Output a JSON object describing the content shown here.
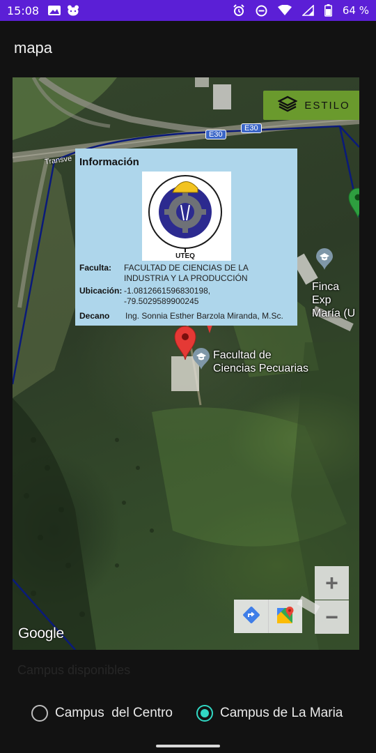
{
  "status_bar": {
    "time": "15:08",
    "battery": "64 %",
    "icons": [
      "gallery-icon",
      "cat-face-icon",
      "alarm-icon",
      "do-not-disturb-icon",
      "wifi-icon",
      "signal-icon",
      "battery-icon"
    ]
  },
  "app_bar": {
    "title": "mapa"
  },
  "map": {
    "style_button_label": "ESTILO",
    "road_labels": [
      "Transve",
      "E30",
      "E30"
    ],
    "info_window": {
      "title": "Información",
      "logo_text": "INGENIERIA EN SEGURIDAD INDUSTRIAL Y SALUD OCUPACIONAL",
      "logo_subtext": "UTEQ",
      "rows": [
        {
          "label": "Faculta:",
          "value": "FACULTAD DE CIENCIAS DE LA\nINDUSTRIA Y LA PRODUCCIÓN"
        },
        {
          "label": "Ubicación:",
          "value": "-1.0812661596830198,\n-79.5029589900245"
        },
        {
          "label": "Decano",
          "value": "Ing. Sonnia Esther Barzola Miranda, M.Sc."
        }
      ]
    },
    "places": [
      {
        "label": "Facultad de\nCiencias Pecuarias"
      },
      {
        "label": "Finca Exp\nMaría (U"
      }
    ],
    "zoom_in_label": "+",
    "zoom_out_label": "−",
    "attribution": "Google",
    "colors": {
      "red_marker": "#e53935",
      "green_marker": "#2e9e3f",
      "place_pin": "#7f97a8",
      "boundary_line": "#0a1a7a"
    }
  },
  "bottom": {
    "section_label": "Campus disponibles",
    "options": [
      {
        "label": "Campus  del Centro",
        "checked": false
      },
      {
        "label": "Campus de La Maria",
        "checked": true
      }
    ],
    "accent_color": "#31d8c4"
  }
}
